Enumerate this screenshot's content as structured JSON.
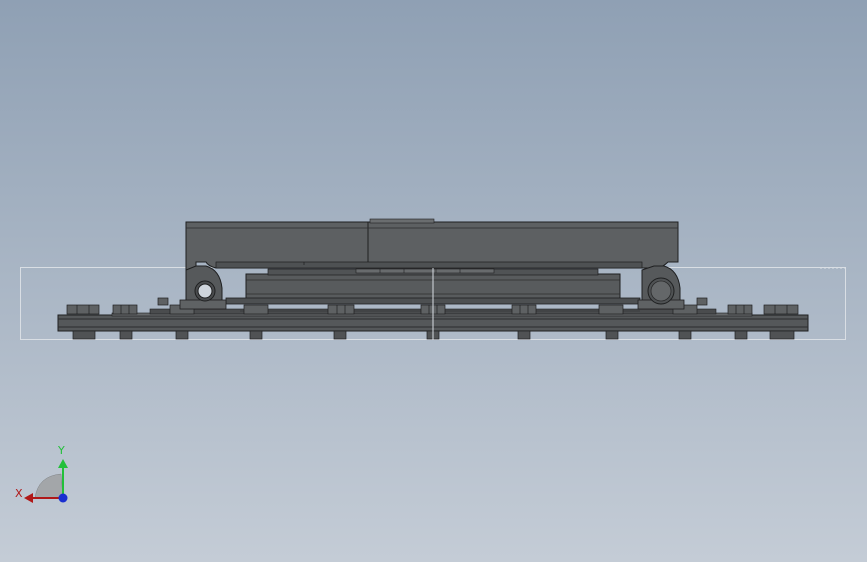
{
  "viewport": {
    "background_top": "#8fa0b4",
    "background_bottom": "#c4ccd6"
  },
  "model": {
    "body_color": "#5a5c5e",
    "dark_color": "#3e4042",
    "light_color": "#75787a",
    "edge_color": "#1e1f20"
  },
  "triad": {
    "y_label": "Y",
    "x_label": "X",
    "y_color": "#22c03a",
    "x_color": "#b01818",
    "z_color": "#1a2fd0"
  }
}
